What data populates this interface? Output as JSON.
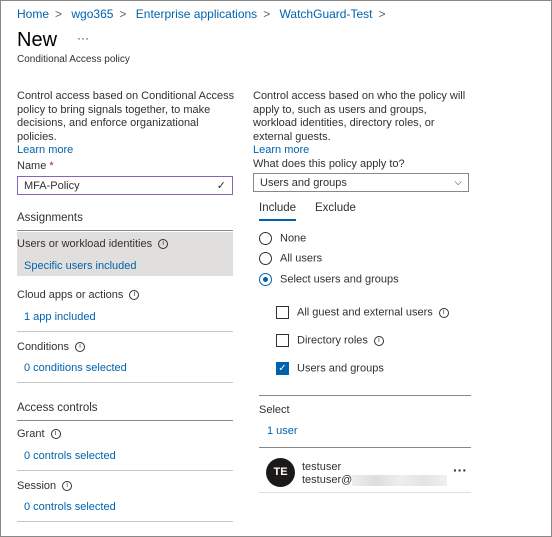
{
  "breadcrumb": [
    "Home",
    "wgo365",
    "Enterprise applications",
    "WatchGuard-Test"
  ],
  "title": "New",
  "more": "···",
  "subtitle": "Conditional Access policy",
  "left": {
    "description": "Control access based on Conditional Access policy to bring signals together, to make decisions, and enforce organizational policies.",
    "learn_more": "Learn more",
    "name_label": "Name",
    "required": "*",
    "name_value": "MFA-Policy",
    "assignments": "Assignments",
    "users_label": "Users or workload identities",
    "users_value": "Specific users included",
    "cloud_label": "Cloud apps or actions",
    "cloud_value": "1 app included",
    "conditions_label": "Conditions",
    "conditions_value": "0 conditions selected",
    "access_controls": "Access controls",
    "grant_label": "Grant",
    "grant_value": "0 controls selected",
    "session_label": "Session",
    "session_value": "0 controls selected"
  },
  "right": {
    "description": "Control access based on who the policy will apply to, such as users and groups, workload identities, directory roles, or external guests.",
    "learn_more": "Learn more",
    "apply_label": "What does this policy apply to?",
    "apply_value": "Users and groups",
    "tabs": [
      "Include",
      "Exclude"
    ],
    "radios": [
      {
        "label": "None",
        "selected": false
      },
      {
        "label": "All users",
        "selected": false
      },
      {
        "label": "Select users and groups",
        "selected": true
      }
    ],
    "checks": [
      {
        "label": "All guest and external users",
        "checked": false
      },
      {
        "label": "Directory roles",
        "checked": false
      },
      {
        "label": "Users and groups",
        "checked": true
      }
    ],
    "select_label": "Select",
    "select_value": "1 user",
    "user": {
      "initials": "TE",
      "name": "testuser",
      "email": "testuser@"
    }
  },
  "colors": {
    "accent": "#0062ad",
    "selected_bg": "#e1dfdd"
  }
}
